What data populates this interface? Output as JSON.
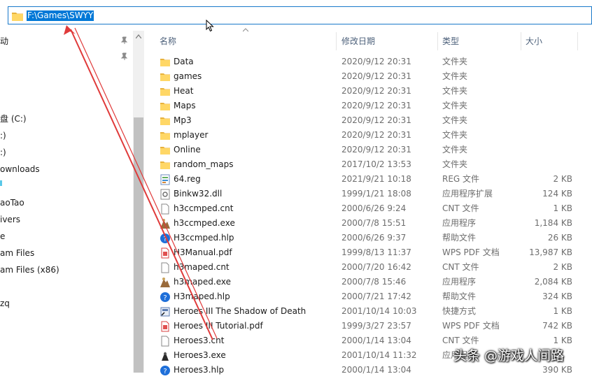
{
  "address": {
    "path": "F:\\Games\\SWYY"
  },
  "nav": {
    "items": [
      {
        "label": "动"
      },
      {
        "label": ""
      },
      {
        "label": ""
      },
      {
        "label": ""
      },
      {
        "label": "盘 (C:)"
      },
      {
        "label": ":)"
      },
      {
        "label": ":)"
      },
      {
        "label": "ownloads"
      },
      {
        "label": ""
      },
      {
        "label": "aoTao"
      },
      {
        "label": "ivers"
      },
      {
        "label": "e"
      },
      {
        "label": "am Files"
      },
      {
        "label": "am Files (x86)"
      },
      {
        "label": ""
      },
      {
        "label": "zq"
      }
    ]
  },
  "columns": {
    "name": "名称",
    "date": "修改日期",
    "type": "类型",
    "size": "大小"
  },
  "files": [
    {
      "name": "Data",
      "date": "2020/9/12 20:31",
      "type": "文件夹",
      "size": "",
      "icon": "folder"
    },
    {
      "name": "games",
      "date": "2020/9/12 20:31",
      "type": "文件夹",
      "size": "",
      "icon": "folder"
    },
    {
      "name": "Heat",
      "date": "2020/9/12 20:31",
      "type": "文件夹",
      "size": "",
      "icon": "folder"
    },
    {
      "name": "Maps",
      "date": "2020/9/12 20:31",
      "type": "文件夹",
      "size": "",
      "icon": "folder"
    },
    {
      "name": "Mp3",
      "date": "2020/9/12 20:31",
      "type": "文件夹",
      "size": "",
      "icon": "folder"
    },
    {
      "name": "mplayer",
      "date": "2020/9/12 20:31",
      "type": "文件夹",
      "size": "",
      "icon": "folder"
    },
    {
      "name": "Online",
      "date": "2020/9/12 20:31",
      "type": "文件夹",
      "size": "",
      "icon": "folder"
    },
    {
      "name": "random_maps",
      "date": "2017/10/2 13:53",
      "type": "文件夹",
      "size": "",
      "icon": "folder"
    },
    {
      "name": "64.reg",
      "date": "2021/9/21 10:18",
      "type": "REG 文件",
      "size": "2 KB",
      "icon": "reg"
    },
    {
      "name": "Binkw32.dll",
      "date": "1999/1/21 18:08",
      "type": "应用程序扩展",
      "size": "124 KB",
      "icon": "dll"
    },
    {
      "name": "h3ccmped.cnt",
      "date": "2000/6/26 9:24",
      "type": "CNT 文件",
      "size": "1 KB",
      "icon": "doc"
    },
    {
      "name": "h3ccmped.exe",
      "date": "2000/7/8 15:51",
      "type": "应用程序",
      "size": "1,184 KB",
      "icon": "exe"
    },
    {
      "name": "H3ccmped.hlp",
      "date": "2000/6/26 9:37",
      "type": "帮助文件",
      "size": "26 KB",
      "icon": "help"
    },
    {
      "name": "H3Manual.pdf",
      "date": "1999/8/13 11:37",
      "type": "WPS PDF 文档",
      "size": "13,987 KB",
      "icon": "pdf"
    },
    {
      "name": "h3maped.cnt",
      "date": "2000/7/20 16:42",
      "type": "CNT 文件",
      "size": "2 KB",
      "icon": "doc"
    },
    {
      "name": "h3maped.exe",
      "date": "2000/7/8 15:46",
      "type": "应用程序",
      "size": "2,084 KB",
      "icon": "exe"
    },
    {
      "name": "H3maped.hlp",
      "date": "2000/7/21 17:42",
      "type": "帮助文件",
      "size": "324 KB",
      "icon": "help"
    },
    {
      "name": "Heroes III The Shadow of Death",
      "date": "2001/10/14 10:03",
      "type": "快捷方式",
      "size": "1 KB",
      "icon": "shortcut"
    },
    {
      "name": "Heroes III Tutorial.pdf",
      "date": "1999/3/27 23:57",
      "type": "WPS PDF 文档",
      "size": "742 KB",
      "icon": "pdf"
    },
    {
      "name": "Heroes3.cnt",
      "date": "2000/1/14 13:04",
      "type": "CNT 文件",
      "size": "1 KB",
      "icon": "doc"
    },
    {
      "name": "Heroes3.exe",
      "date": "2001/10/14 11:32",
      "type": "应用程序",
      "size": "",
      "icon": "exe-dark"
    },
    {
      "name": "Heroes3.hlp",
      "date": "2000/1/14 13:04",
      "type": "",
      "size": "390 KB",
      "icon": "help"
    }
  ],
  "watermark": "头条 @游戏人间路",
  "colors": {
    "accent": "#0078d7",
    "annotation": "#e03a3a",
    "folder": "#ffd766"
  }
}
